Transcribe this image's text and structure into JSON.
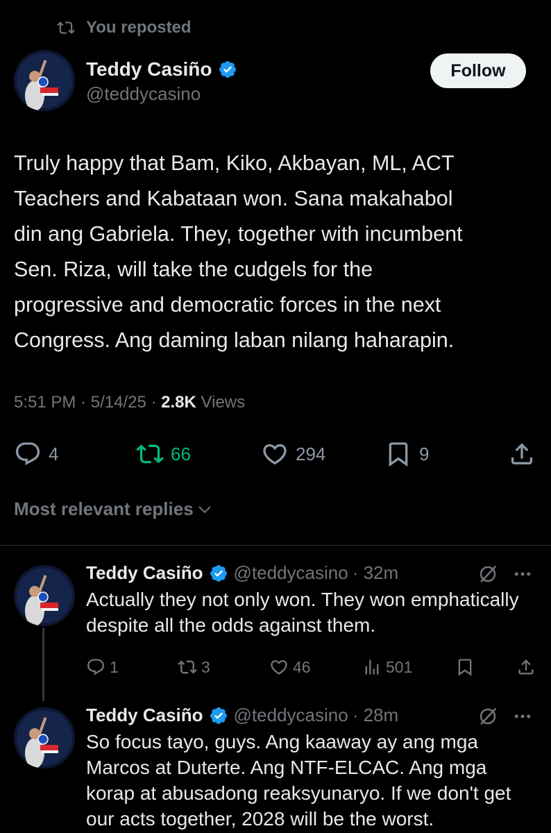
{
  "repost": {
    "label": "You reposted"
  },
  "tweet": {
    "author_name": "Teddy Casiño",
    "author_handle": "@teddycasino",
    "follow_label": "Follow",
    "text": "Truly happy that Bam, Kiko, Akbayan, ML, ACT\nTeachers and Kabataan won. Sana makahabol\ndin ang Gabriela. They, together with incumbent\nSen. Riza, will take the cudgels for the\nprogressive and democratic forces in the next\nCongress. Ang daming laban nilang haharapin.",
    "time": "5:51 PM",
    "date": "5/14/25",
    "views_count": "2.8K",
    "views_label": "Views",
    "stats": {
      "replies": "4",
      "reposts": "66",
      "likes": "294",
      "bookmarks": "9"
    },
    "colors": {
      "repost_active": "#00ba7c",
      "verified": "#1d9bf0"
    }
  },
  "replies_header": {
    "label": "Most relevant replies"
  },
  "replies": [
    {
      "author_name": "Teddy Casiño",
      "author_handle": "@teddycasino",
      "time_ago": "· 32m",
      "text": "Actually they not only won. They won emphatically despite all the odds against them.",
      "stats": {
        "replies": "1",
        "reposts": "3",
        "likes": "46",
        "views": "501"
      }
    },
    {
      "author_name": "Teddy Casiño",
      "author_handle": "@teddycasino",
      "time_ago": "· 28m",
      "text": "So focus tayo, guys. Ang kaaway ay ang mga Marcos at Duterte. Ang NTF-ELCAC. Ang mga korap at abusadong reaksyunaryo. If we don't get our acts together, 2028 will be the worst."
    }
  ]
}
